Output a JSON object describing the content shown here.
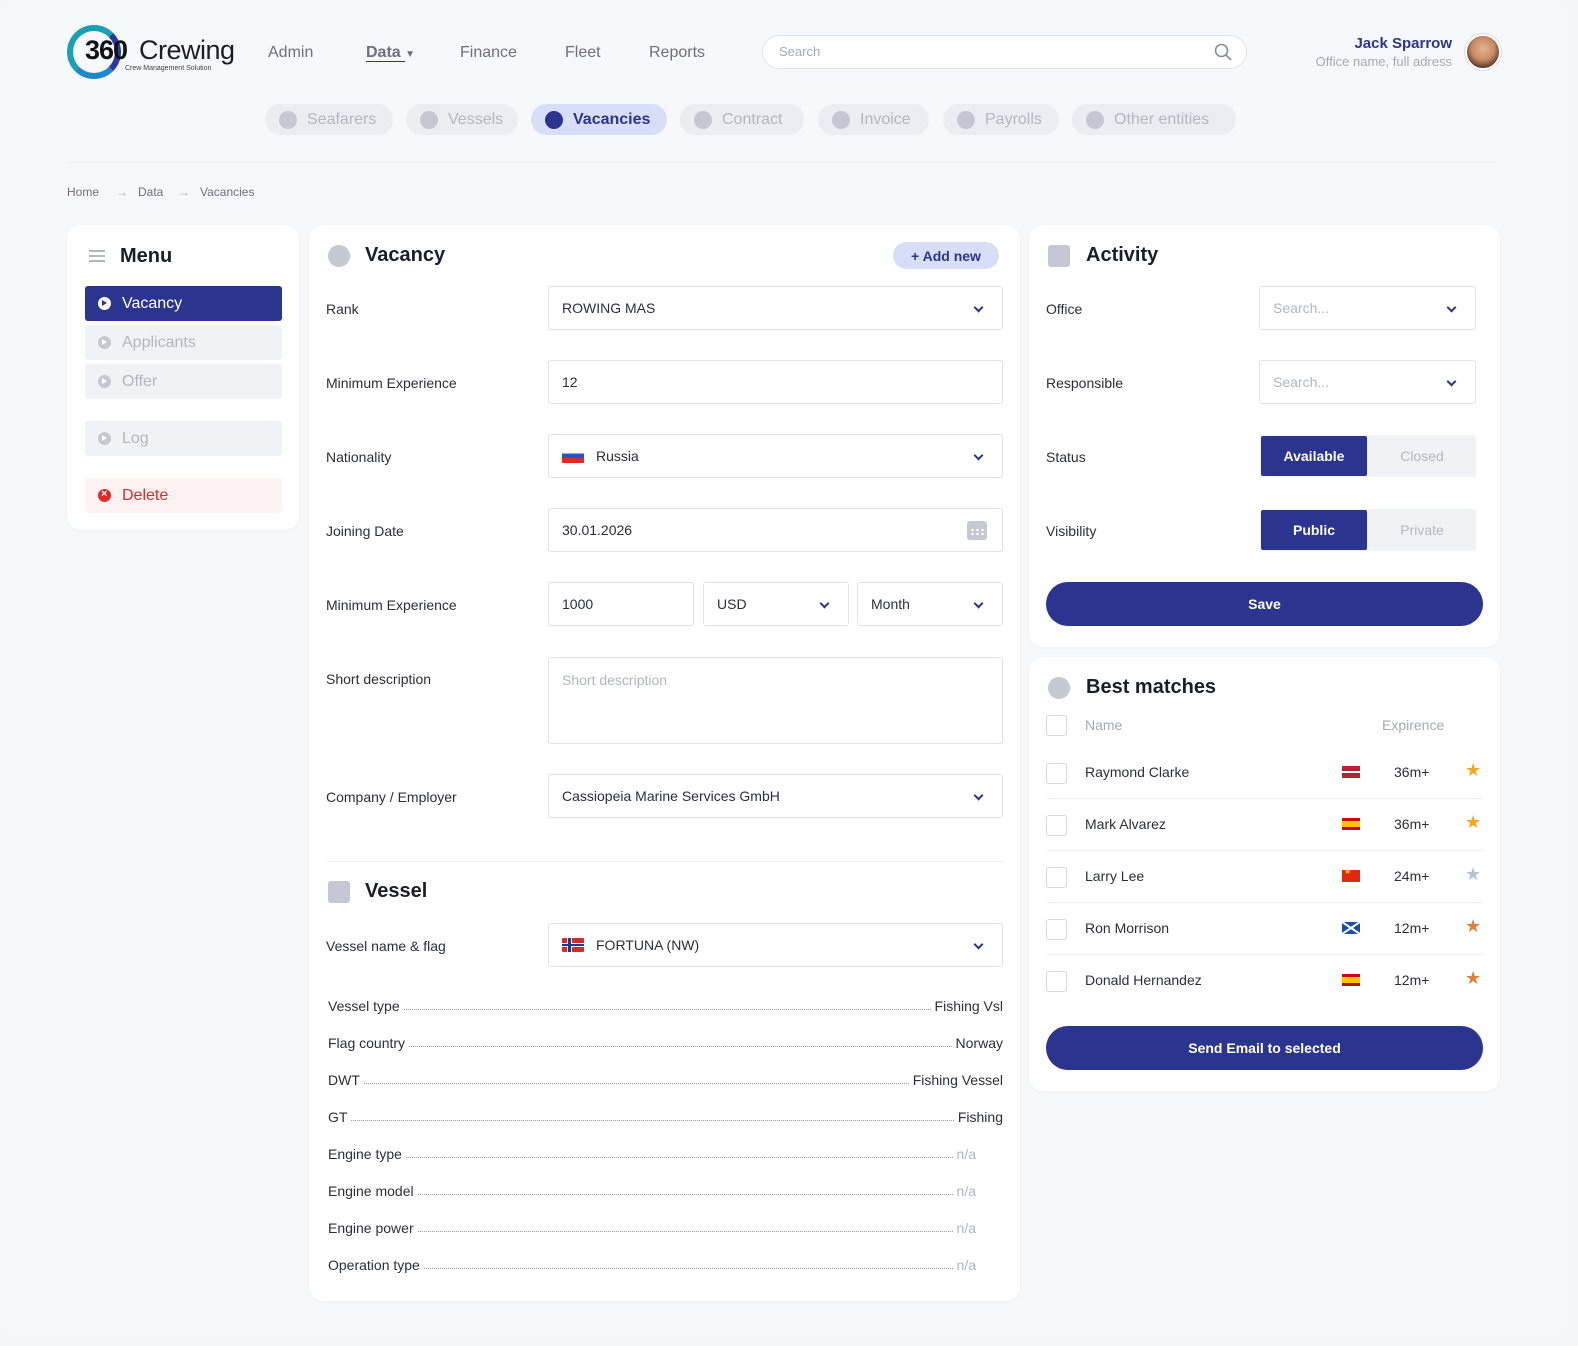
{
  "header": {
    "logo_number": "360",
    "logo_word": "Crewing",
    "logo_tagline": "Crew Management Solution",
    "nav": [
      "Admin",
      "Data",
      "Finance",
      "Fleet",
      "Reports"
    ],
    "search_placeholder": "Search",
    "user_name": "Jack Sparrow",
    "user_office": "Office name, full adress"
  },
  "tabs": [
    "Seafarers",
    "Vessels",
    "Vacancies",
    "Contract",
    "Invoice",
    "Payrolls",
    "Other entities"
  ],
  "active_tab": "Vacancies",
  "breadcrumbs": [
    "Home",
    "Data",
    "Vacancies"
  ],
  "menu": {
    "title": "Menu",
    "items": [
      "Vacancy",
      "Applicants",
      "Offer",
      "Log",
      "Delete"
    ]
  },
  "vacancy": {
    "title": "Vacancy",
    "add_new": "+ Add new",
    "fields": {
      "rank_label": "Rank",
      "rank_value": "ROWING MAS",
      "min_exp_label": "Minimum Experience",
      "min_exp_value": "12",
      "nationality_label": "Nationality",
      "nationality_value": "Russia",
      "joining_label": "Joining Date",
      "joining_value": "30.01.2026",
      "salary_label": "Minimum Experience",
      "salary_amount": "1000",
      "salary_currency": "USD",
      "salary_period": "Month",
      "short_desc_label": "Short description",
      "short_desc_placeholder": "Short description",
      "company_label": "Company / Employer",
      "company_value": "Cassiopeia Marine Services GmbH"
    }
  },
  "vessel": {
    "title": "Vessel",
    "name_label": "Vessel name & flag",
    "name_value": "FORTUNA (NW)",
    "details": [
      {
        "k": "Vessel type",
        "v": "Fishing Vsl"
      },
      {
        "k": "Flag country",
        "v": "Norway"
      },
      {
        "k": "DWT",
        "v": "Fishing Vessel"
      },
      {
        "k": "GT",
        "v": "Fishing"
      },
      {
        "k": "Engine type",
        "v": "n/a"
      },
      {
        "k": "Engine model",
        "v": "n/a"
      },
      {
        "k": "Engine power",
        "v": "n/a"
      },
      {
        "k": "Operation type",
        "v": "n/a"
      }
    ]
  },
  "activity": {
    "title": "Activity",
    "office_label": "Office",
    "office_placeholder": "Search...",
    "responsible_label": "Responsible",
    "responsible_placeholder": "Search...",
    "status_label": "Status",
    "status_on": "Available",
    "status_off": "Closed",
    "visibility_label": "Visibility",
    "visibility_on": "Public",
    "visibility_off": "Private",
    "save": "Save"
  },
  "matches": {
    "title": "Best matches",
    "col_name": "Name",
    "col_exp": "Expirence",
    "rows": [
      {
        "name": "Raymond Clarke",
        "exp": "36m+",
        "flag": "latvia",
        "star": "gold"
      },
      {
        "name": "Mark Alvarez",
        "exp": "36m+",
        "flag": "spain",
        "star": "gold"
      },
      {
        "name": "Larry Lee",
        "exp": "24m+",
        "flag": "china",
        "star": "silver"
      },
      {
        "name": "Ron Morrison",
        "exp": "12m+",
        "flag": "scotland",
        "star": "bronze"
      },
      {
        "name": "Donald Hernandez",
        "exp": "12m+",
        "flag": "spain",
        "star": "bronze"
      }
    ],
    "send": "Send Email to selected"
  },
  "colors": {
    "accent": "#2b3590",
    "danger": "#e02a2a",
    "gold": "#f5a623",
    "silver": "#b9c1d6",
    "bronze": "#e0813a"
  }
}
